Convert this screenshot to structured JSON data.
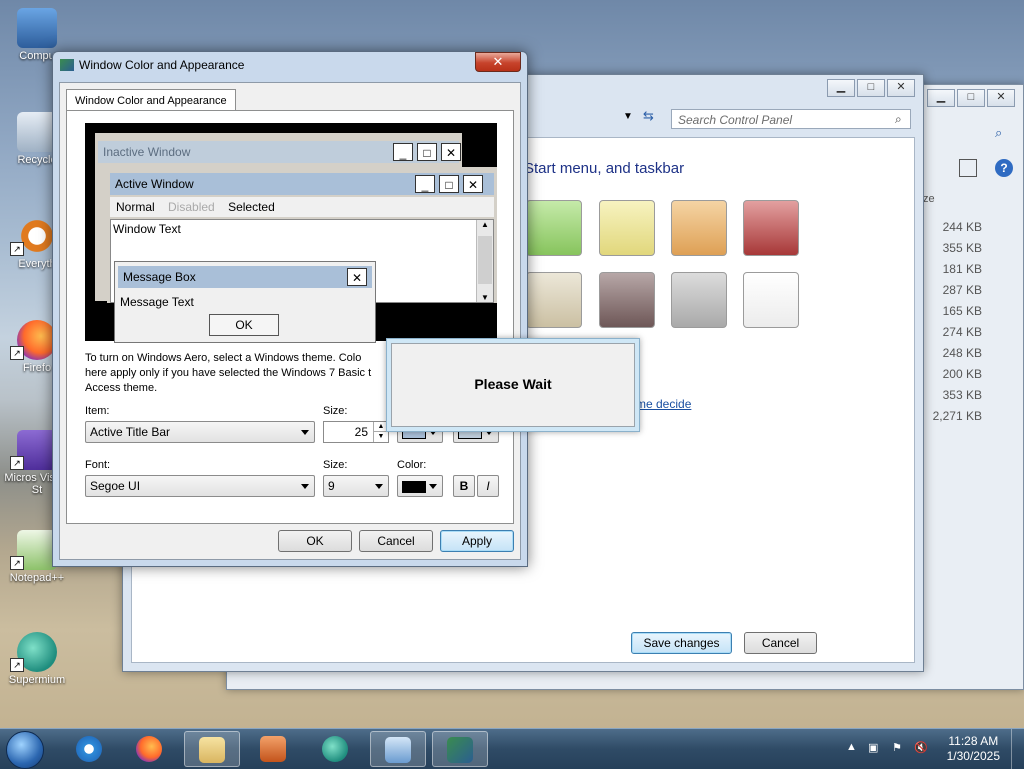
{
  "desktop": {
    "icons": [
      {
        "label": "Compu"
      },
      {
        "label": "Recycle"
      },
      {
        "label": "Everyth"
      },
      {
        "label": "Firefo"
      },
      {
        "label": "Micros Visual St"
      },
      {
        "label": "Notepad++"
      },
      {
        "label": "Supermium"
      }
    ]
  },
  "control_panel": {
    "search_placeholder": "Search Control Panel",
    "heading_partial": "Start menu, and taskbar",
    "link_partial": "me decide",
    "save_label": "Save changes",
    "cancel_label": "Cancel",
    "swatch_colors": [
      "#9ed27e",
      "#e9e49a",
      "#e8b46f",
      "#b94545",
      "#d9d0b9",
      "#7e6767",
      "#b9b9b9",
      "#f4f4f4"
    ],
    "file_sizes": [
      "244 KB",
      "355 KB",
      "181 KB",
      "287 KB",
      "165 KB",
      "274 KB",
      "248 KB",
      "200 KB",
      "353 KB",
      "2,271 KB"
    ],
    "size_header_partial": "ze"
  },
  "dialog": {
    "title": "Window Color and Appearance",
    "tab_label": "Window Color and Appearance",
    "preview": {
      "inactive_title": "Inactive Window",
      "active_title": "Active Window",
      "menu": [
        "Normal",
        "Disabled",
        "Selected"
      ],
      "window_text": "Window Text",
      "message_box_title": "Message Box",
      "message_text": "Message Text",
      "ok_label": "OK"
    },
    "info_line1": "To turn on Windows Aero, select a Windows theme.  Colo",
    "info_line2": "here apply only if you have selected the Windows 7 Basic t",
    "info_line3": "Access theme.",
    "item_label": "Item:",
    "item_value": "Active Title Bar",
    "size_label": "Size:",
    "size_value": "25",
    "font_label": "Font:",
    "font_value": "Segoe UI",
    "font_size_label": "Size:",
    "font_size_value": "9",
    "color_label": "Color:",
    "bold_label": "B",
    "italic_label": "I",
    "ok_label": "OK",
    "cancel_label": "Cancel",
    "apply_label": "Apply"
  },
  "please_wait": {
    "text": "Please Wait"
  },
  "taskbar": {
    "time": "11:28 AM",
    "date": "1/30/2025"
  }
}
